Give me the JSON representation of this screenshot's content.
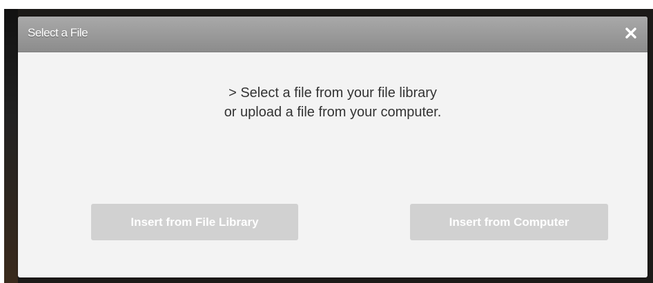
{
  "dialog": {
    "title": "Select a File",
    "close_icon": "close-icon",
    "message_line1": "> Select a file from your file library",
    "message_line2": "or upload a file from your computer.",
    "buttons": {
      "library_label": "Insert from File Library",
      "computer_label": "Insert from Computer"
    }
  },
  "colors": {
    "header_bg": "#999999",
    "body_bg": "#f3f3f3",
    "button_bg": "#d1d1d1",
    "button_text": "#ffffff",
    "message_text": "#333333"
  }
}
